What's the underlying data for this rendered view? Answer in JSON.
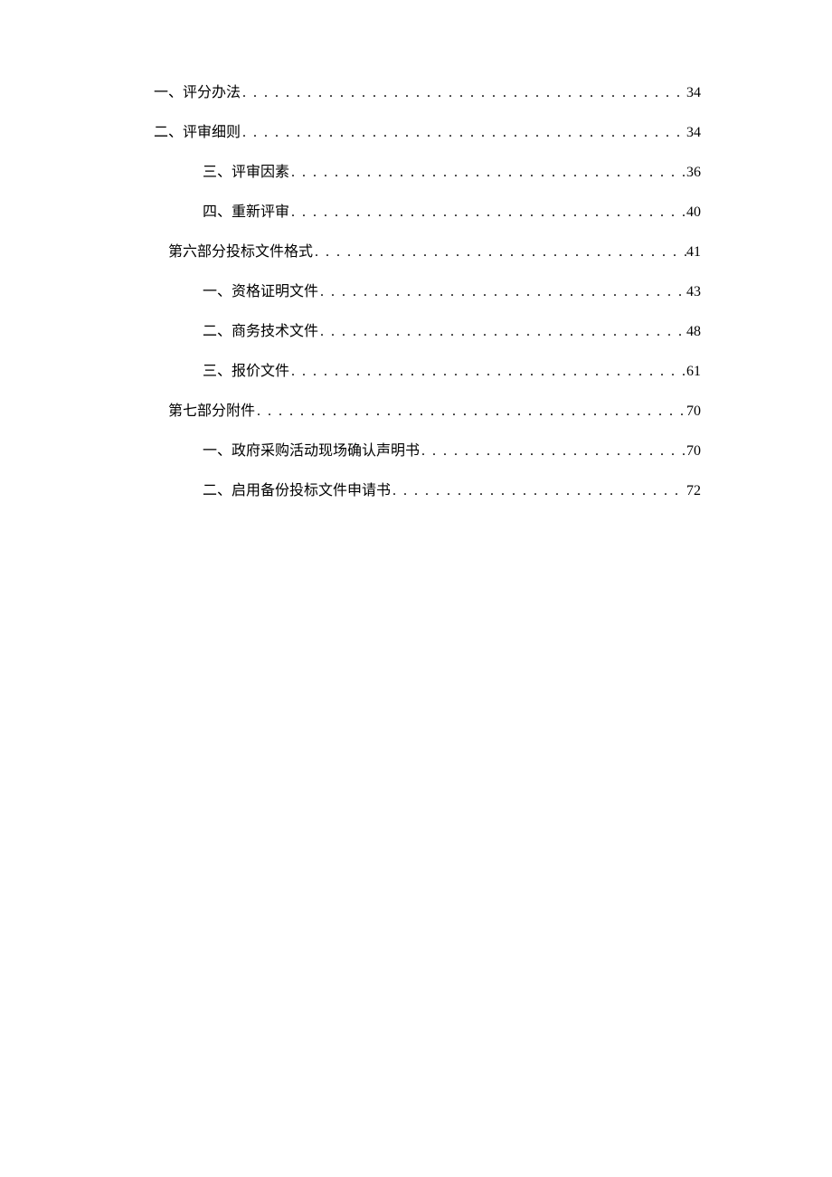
{
  "toc": [
    {
      "indent": 0,
      "title": "一、评分办法",
      "page": "34"
    },
    {
      "indent": 0,
      "title": "二、评审细则",
      "page": "34"
    },
    {
      "indent": 2,
      "title": "三、评审因素",
      "page": "36"
    },
    {
      "indent": 2,
      "title": "四、重新评审",
      "page": "40"
    },
    {
      "indent": 1,
      "title": "第六部分投标文件格式",
      "page": "41"
    },
    {
      "indent": 2,
      "title": "一、资格证明文件",
      "page": "43"
    },
    {
      "indent": 2,
      "title": "二、商务技术文件",
      "page": "48"
    },
    {
      "indent": 2,
      "title": "三、报价文件",
      "page": "61"
    },
    {
      "indent": 1,
      "title": "第七部分附件",
      "page": "70"
    },
    {
      "indent": 2,
      "title": "一、政府采购活动现场确认声明书",
      "page": "70"
    },
    {
      "indent": 2,
      "title": "二、启用备份投标文件申请书",
      "page": "72"
    }
  ]
}
